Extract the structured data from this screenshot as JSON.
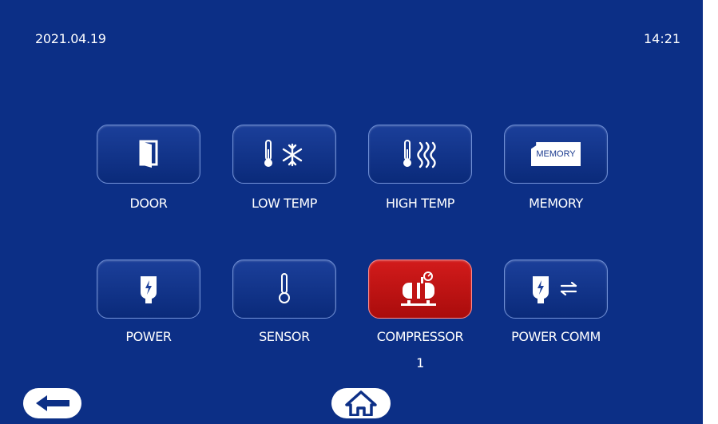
{
  "status_bar": {
    "date": "2021.04.19",
    "time": "14:21"
  },
  "tiles": [
    {
      "label": "DOOR",
      "icon": "door-icon",
      "state": "normal"
    },
    {
      "label": "LOW TEMP",
      "icon": "thermometer-snowflake-icon",
      "state": "normal"
    },
    {
      "label": "HIGH TEMP",
      "icon": "thermometer-heat-icon",
      "state": "normal"
    },
    {
      "label": "MEMORY",
      "icon": "memory-card-icon",
      "icon_text": "MEMORY",
      "state": "normal"
    },
    {
      "label": "POWER",
      "icon": "power-plug-icon",
      "state": "normal"
    },
    {
      "label": "SENSOR",
      "icon": "sensor-probe-icon",
      "state": "normal"
    },
    {
      "label": "COMPRESSOR",
      "sublabel": "1",
      "icon": "compressor-icon",
      "state": "alarm"
    },
    {
      "label": "POWER COMM",
      "icon": "power-comm-icon",
      "state": "normal"
    }
  ],
  "nav": {
    "back_icon": "arrow-left-icon",
    "home_icon": "home-icon"
  },
  "colors": {
    "background": "#0c2f86",
    "alarm": "#c21414",
    "button": "#123a92",
    "text": "#ffffff"
  }
}
